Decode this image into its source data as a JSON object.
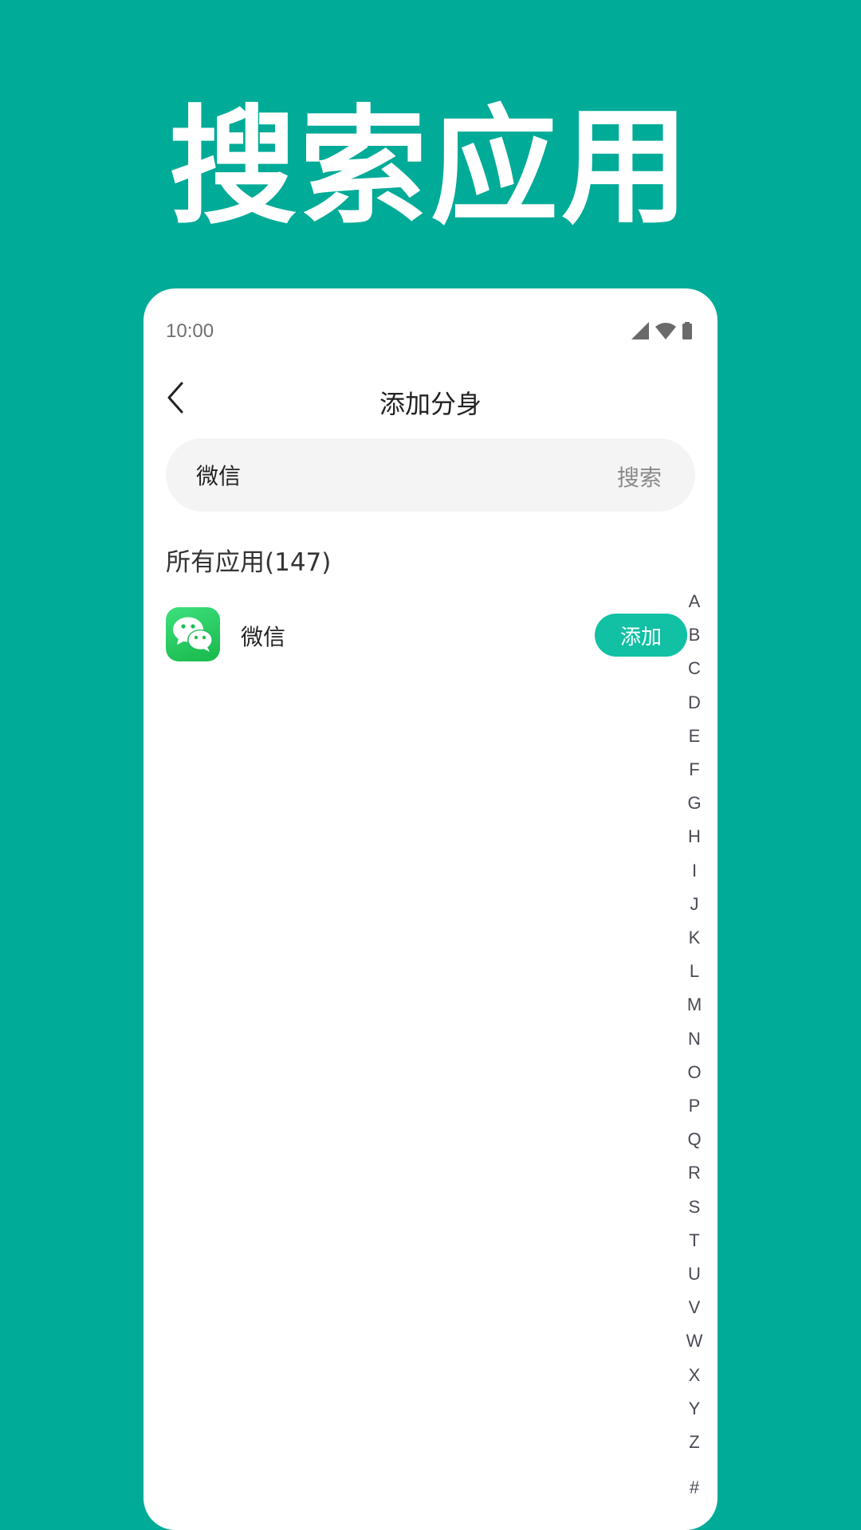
{
  "headline": "搜索应用",
  "status": {
    "time": "10:00"
  },
  "header": {
    "title": "添加分身"
  },
  "search": {
    "value": "微信",
    "button_label": "搜索"
  },
  "section": {
    "title": "所有应用(147)"
  },
  "apps": [
    {
      "name": "微信",
      "icon": "wechat-icon",
      "action_label": "添加"
    }
  ],
  "index_letters": [
    "A",
    "B",
    "C",
    "D",
    "E",
    "F",
    "G",
    "H",
    "I",
    "J",
    "K",
    "L",
    "M",
    "N",
    "O",
    "P",
    "Q",
    "R",
    "S",
    "T",
    "U",
    "V",
    "W",
    "X",
    "Y",
    "Z",
    "#"
  ],
  "colors": {
    "background": "#00ab97",
    "accent": "#12c0a4",
    "wechat_green": "#1fc35a"
  }
}
